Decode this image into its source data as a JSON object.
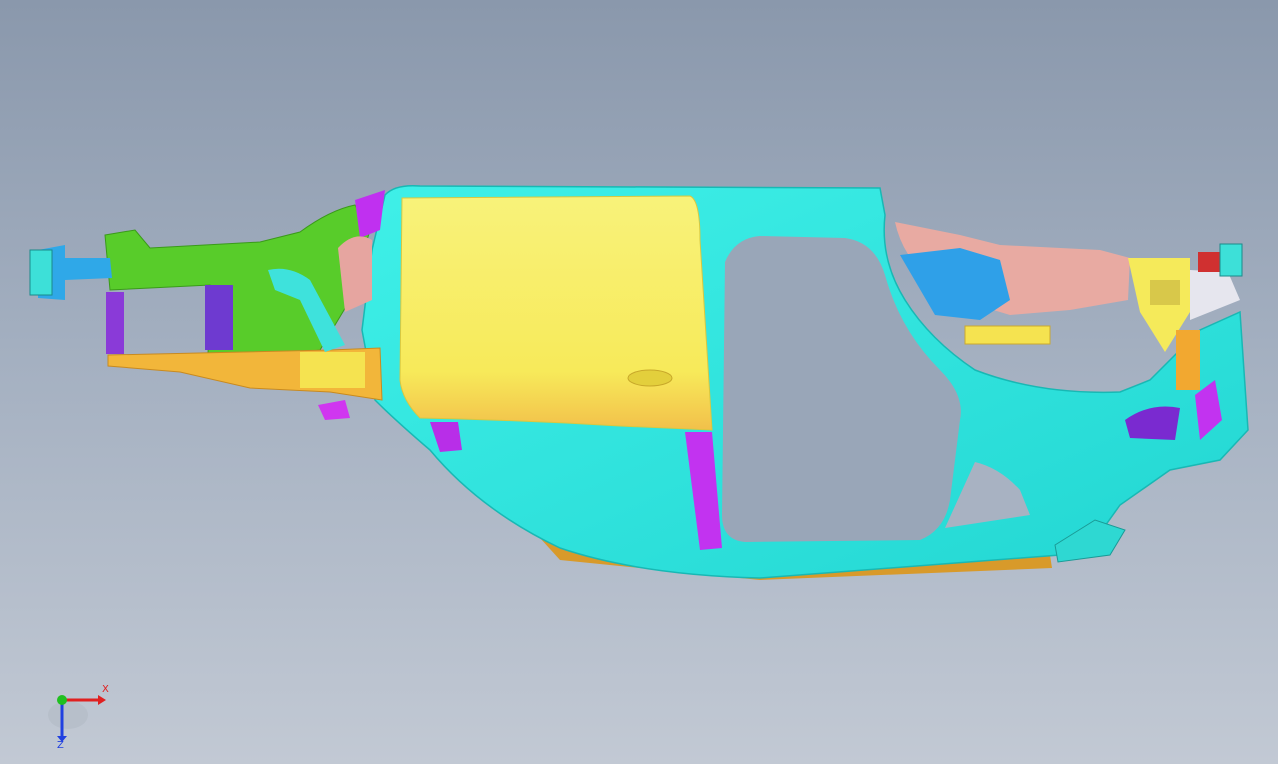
{
  "viewport": {
    "background_top": "#8a98ac",
    "background_bottom": "#c2c9d4"
  },
  "model": {
    "description_icon": "car-body-side-frame-model",
    "colors": {
      "cyan": "#2ee6e0",
      "yellow": "#f7f06a",
      "green": "#5fd42e",
      "magenta": "#cc33ff",
      "orange": "#f2b23a",
      "pink": "#e8a9a2",
      "blue": "#2fa8e8",
      "purple": "#7a2ad0",
      "red": "#d03030"
    }
  },
  "triad": {
    "x_label": "X",
    "z_label": "Z",
    "x_color": "#e02020",
    "y_color": "#20c020",
    "z_color": "#2040e0"
  }
}
